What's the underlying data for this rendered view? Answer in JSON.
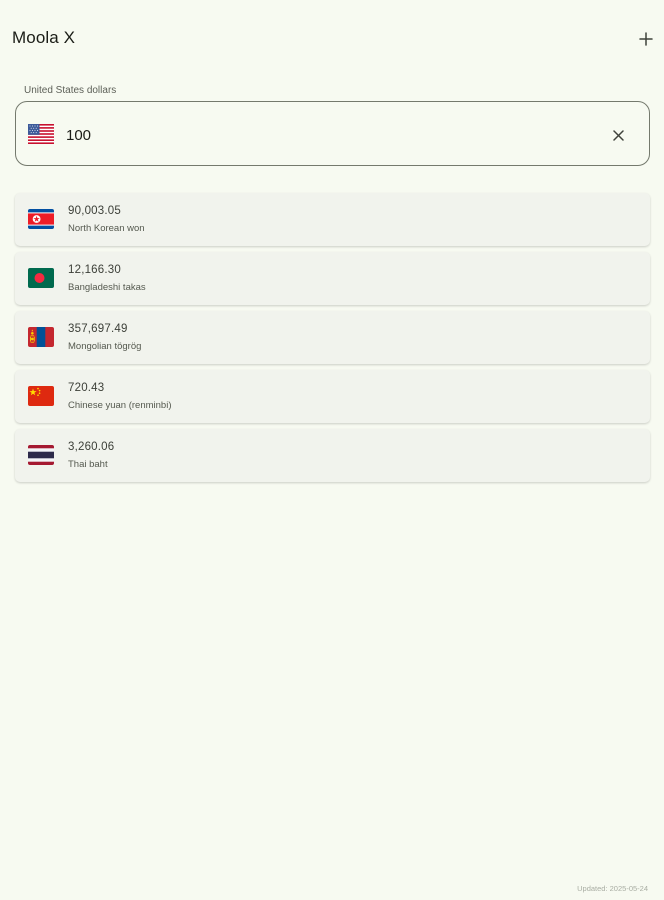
{
  "app": {
    "title": "Moola X",
    "add_icon": "plus-icon"
  },
  "base": {
    "label": "United States dollars",
    "value": "100",
    "flag": "flag-us-icon",
    "clear_icon": "close-icon"
  },
  "conversions": [
    {
      "amount": "90,003.05",
      "name": "North Korean won",
      "flag": "flag-kp-icon"
    },
    {
      "amount": "12,166.30",
      "name": "Bangladeshi takas",
      "flag": "flag-bd-icon"
    },
    {
      "amount": "357,697.49",
      "name": "Mongolian tögrög",
      "flag": "flag-mn-icon"
    },
    {
      "amount": "720.43",
      "name": "Chinese yuan (renminbi)",
      "flag": "flag-cn-icon"
    },
    {
      "amount": "3,260.06",
      "name": "Thai baht",
      "flag": "flag-th-icon"
    }
  ],
  "footer": {
    "updated": "Updated: 2025-05-24"
  },
  "colors": {
    "background": "#f7faf1",
    "card": "#f1f3ed",
    "outline": "#74796d"
  }
}
